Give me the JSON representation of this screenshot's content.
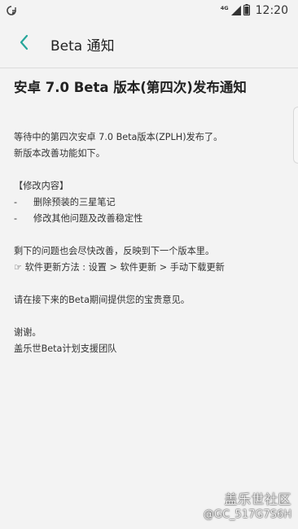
{
  "status_bar": {
    "network_type": "4G",
    "time": "12:20",
    "icons": [
      "sync-icon",
      "signal-icon",
      "battery-icon"
    ]
  },
  "app_bar": {
    "back_icon": "chevron-left-icon",
    "title": "Beta 通知",
    "accent_color": "#26a69a"
  },
  "post": {
    "title": "安卓 7.0 Beta 版本(第四次)发布通知",
    "intro_lines": [
      "等待中的第四次安卓 7.0 Beta版本(ZPLH)发布了。",
      "新版本改善功能如下。"
    ],
    "changes_header": "【修改内容】",
    "changes": [
      {
        "dash": "-",
        "text": "删除预装的三星笔记"
      },
      {
        "dash": "-",
        "text": "修改其他问题及改善稳定性"
      }
    ],
    "followup_lines": [
      "剩下的问题也会尽快改善，反映到下一个版本里。",
      "☞ 软件更新方法 : 设置 > 软件更新 > 手动下载更新"
    ],
    "feedback_line": "请在接下来的Beta期间提供您的宝贵意见。",
    "closing_lines": [
      "谢谢。",
      "盖乐世Beta计划支援团队"
    ]
  },
  "watermark": {
    "brand": "盖乐世社区",
    "user": "@GC_517G7S6H"
  }
}
